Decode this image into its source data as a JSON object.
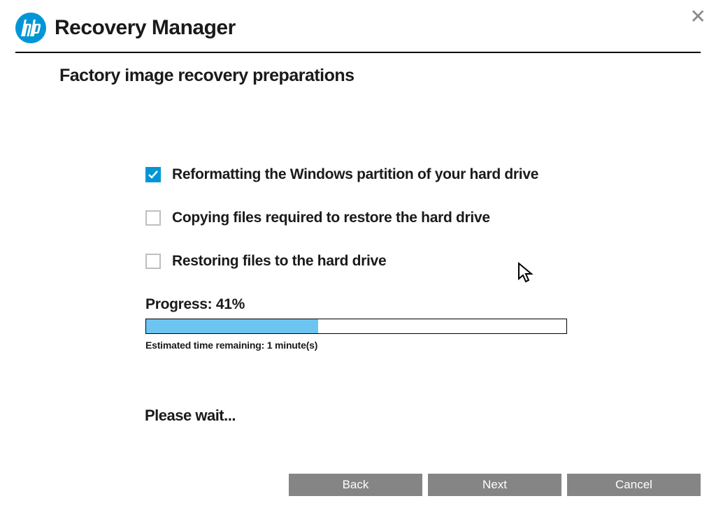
{
  "header": {
    "app_title": "Recovery Manager"
  },
  "page": {
    "title": "Factory image recovery preparations"
  },
  "steps": [
    {
      "label": "Reformatting the Windows partition of your hard drive",
      "checked": true
    },
    {
      "label": "Copying files required to restore the hard drive",
      "checked": false
    },
    {
      "label": "Restoring files to the hard drive",
      "checked": false
    }
  ],
  "progress": {
    "label_prefix": "Progress: ",
    "percent_text": "41%",
    "percent_value": 41,
    "time_remaining": "Estimated time remaining: 1 minute(s)"
  },
  "status": {
    "wait_text": "Please wait..."
  },
  "buttons": {
    "back": "Back",
    "next": "Next",
    "cancel": "Cancel"
  }
}
